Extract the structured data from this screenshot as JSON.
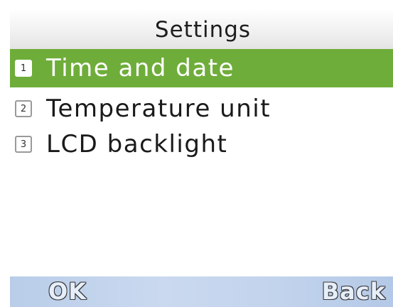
{
  "header": {
    "title": "Settings"
  },
  "menu": {
    "items": [
      {
        "number": "1",
        "label": "Time and date",
        "selected": true
      },
      {
        "number": "2",
        "label": "Temperature unit",
        "selected": false
      },
      {
        "number": "3",
        "label": "LCD backlight",
        "selected": false
      }
    ]
  },
  "softkeys": {
    "left": "OK",
    "right": "Back"
  },
  "colors": {
    "selection": "#6fad3a",
    "softkey_bar": "#c2d3ec",
    "background": "#ffffff"
  }
}
